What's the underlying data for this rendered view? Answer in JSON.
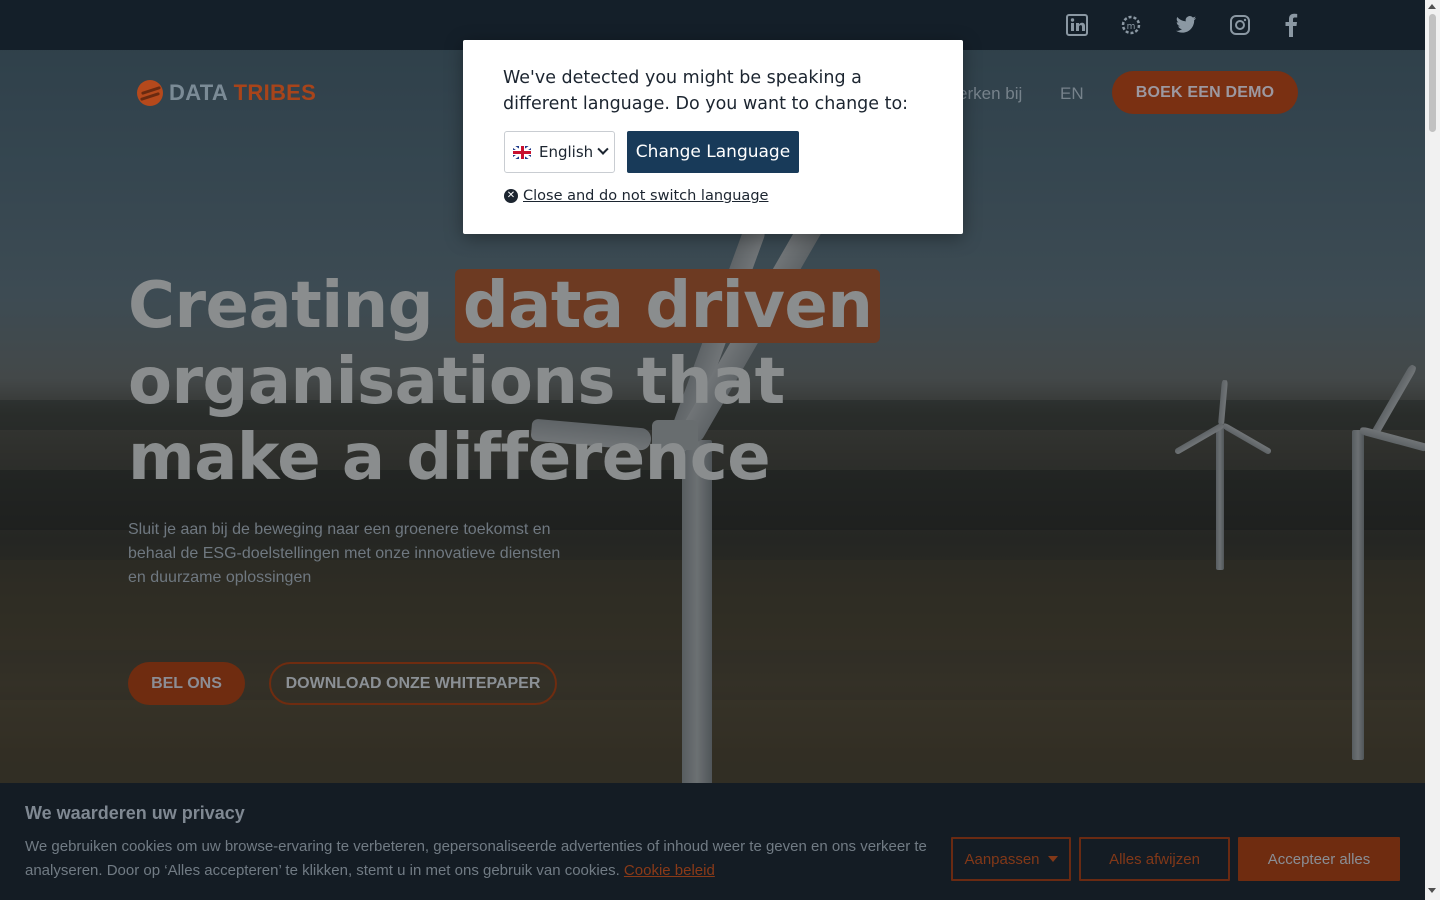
{
  "topbar": {
    "social": [
      {
        "name": "linkedin-icon",
        "glyph": "in"
      },
      {
        "name": "meetup-icon",
        "glyph": "⚙"
      },
      {
        "name": "twitter-icon",
        "glyph": "🐦"
      },
      {
        "name": "instagram-icon",
        "glyph": "◎"
      },
      {
        "name": "facebook-icon",
        "glyph": "f"
      }
    ]
  },
  "nav": {
    "logo_word1": "DATA",
    "logo_word2": "TRIBES",
    "links": [
      "erken bij",
      "EN"
    ],
    "demo_label": "BOEK EEN DEMO"
  },
  "hero": {
    "headline_pre": "Creating ",
    "headline_highlight": "data driven",
    "headline_post": "organisations that make a difference",
    "subtext": "Sluit je aan bij de beweging naar een groenere toekomst en behaal de ESG-doelstellingen met onze innovatieve diensten en duurzame oplossingen",
    "btn_call": "BEL ONS",
    "btn_paper": "DOWNLOAD ONZE WHITEPAPER"
  },
  "language_modal": {
    "message": "We've detected you might be speaking a different language. Do you want to change to:",
    "selected_language": "English",
    "change_button": "Change Language",
    "close_link": "Close and do not switch language"
  },
  "cookie": {
    "title": "We waarderen uw privacy",
    "text": "We gebruiken cookies om uw browse-ervaring te verbeteren, gepersonaliseerde advertenties of inhoud weer te geven en ons verkeer te analyseren. Door op ‘Alles accepteren’ te klikken, stemt u in met ons gebruik van cookies.",
    "policy_link": "Cookie beleid",
    "customize": "Aanpassen",
    "reject": "Alles afwijzen",
    "accept": "Accepteer alles"
  },
  "colors": {
    "brand_orange": "#b5491c",
    "modal_button": "#183a59"
  }
}
